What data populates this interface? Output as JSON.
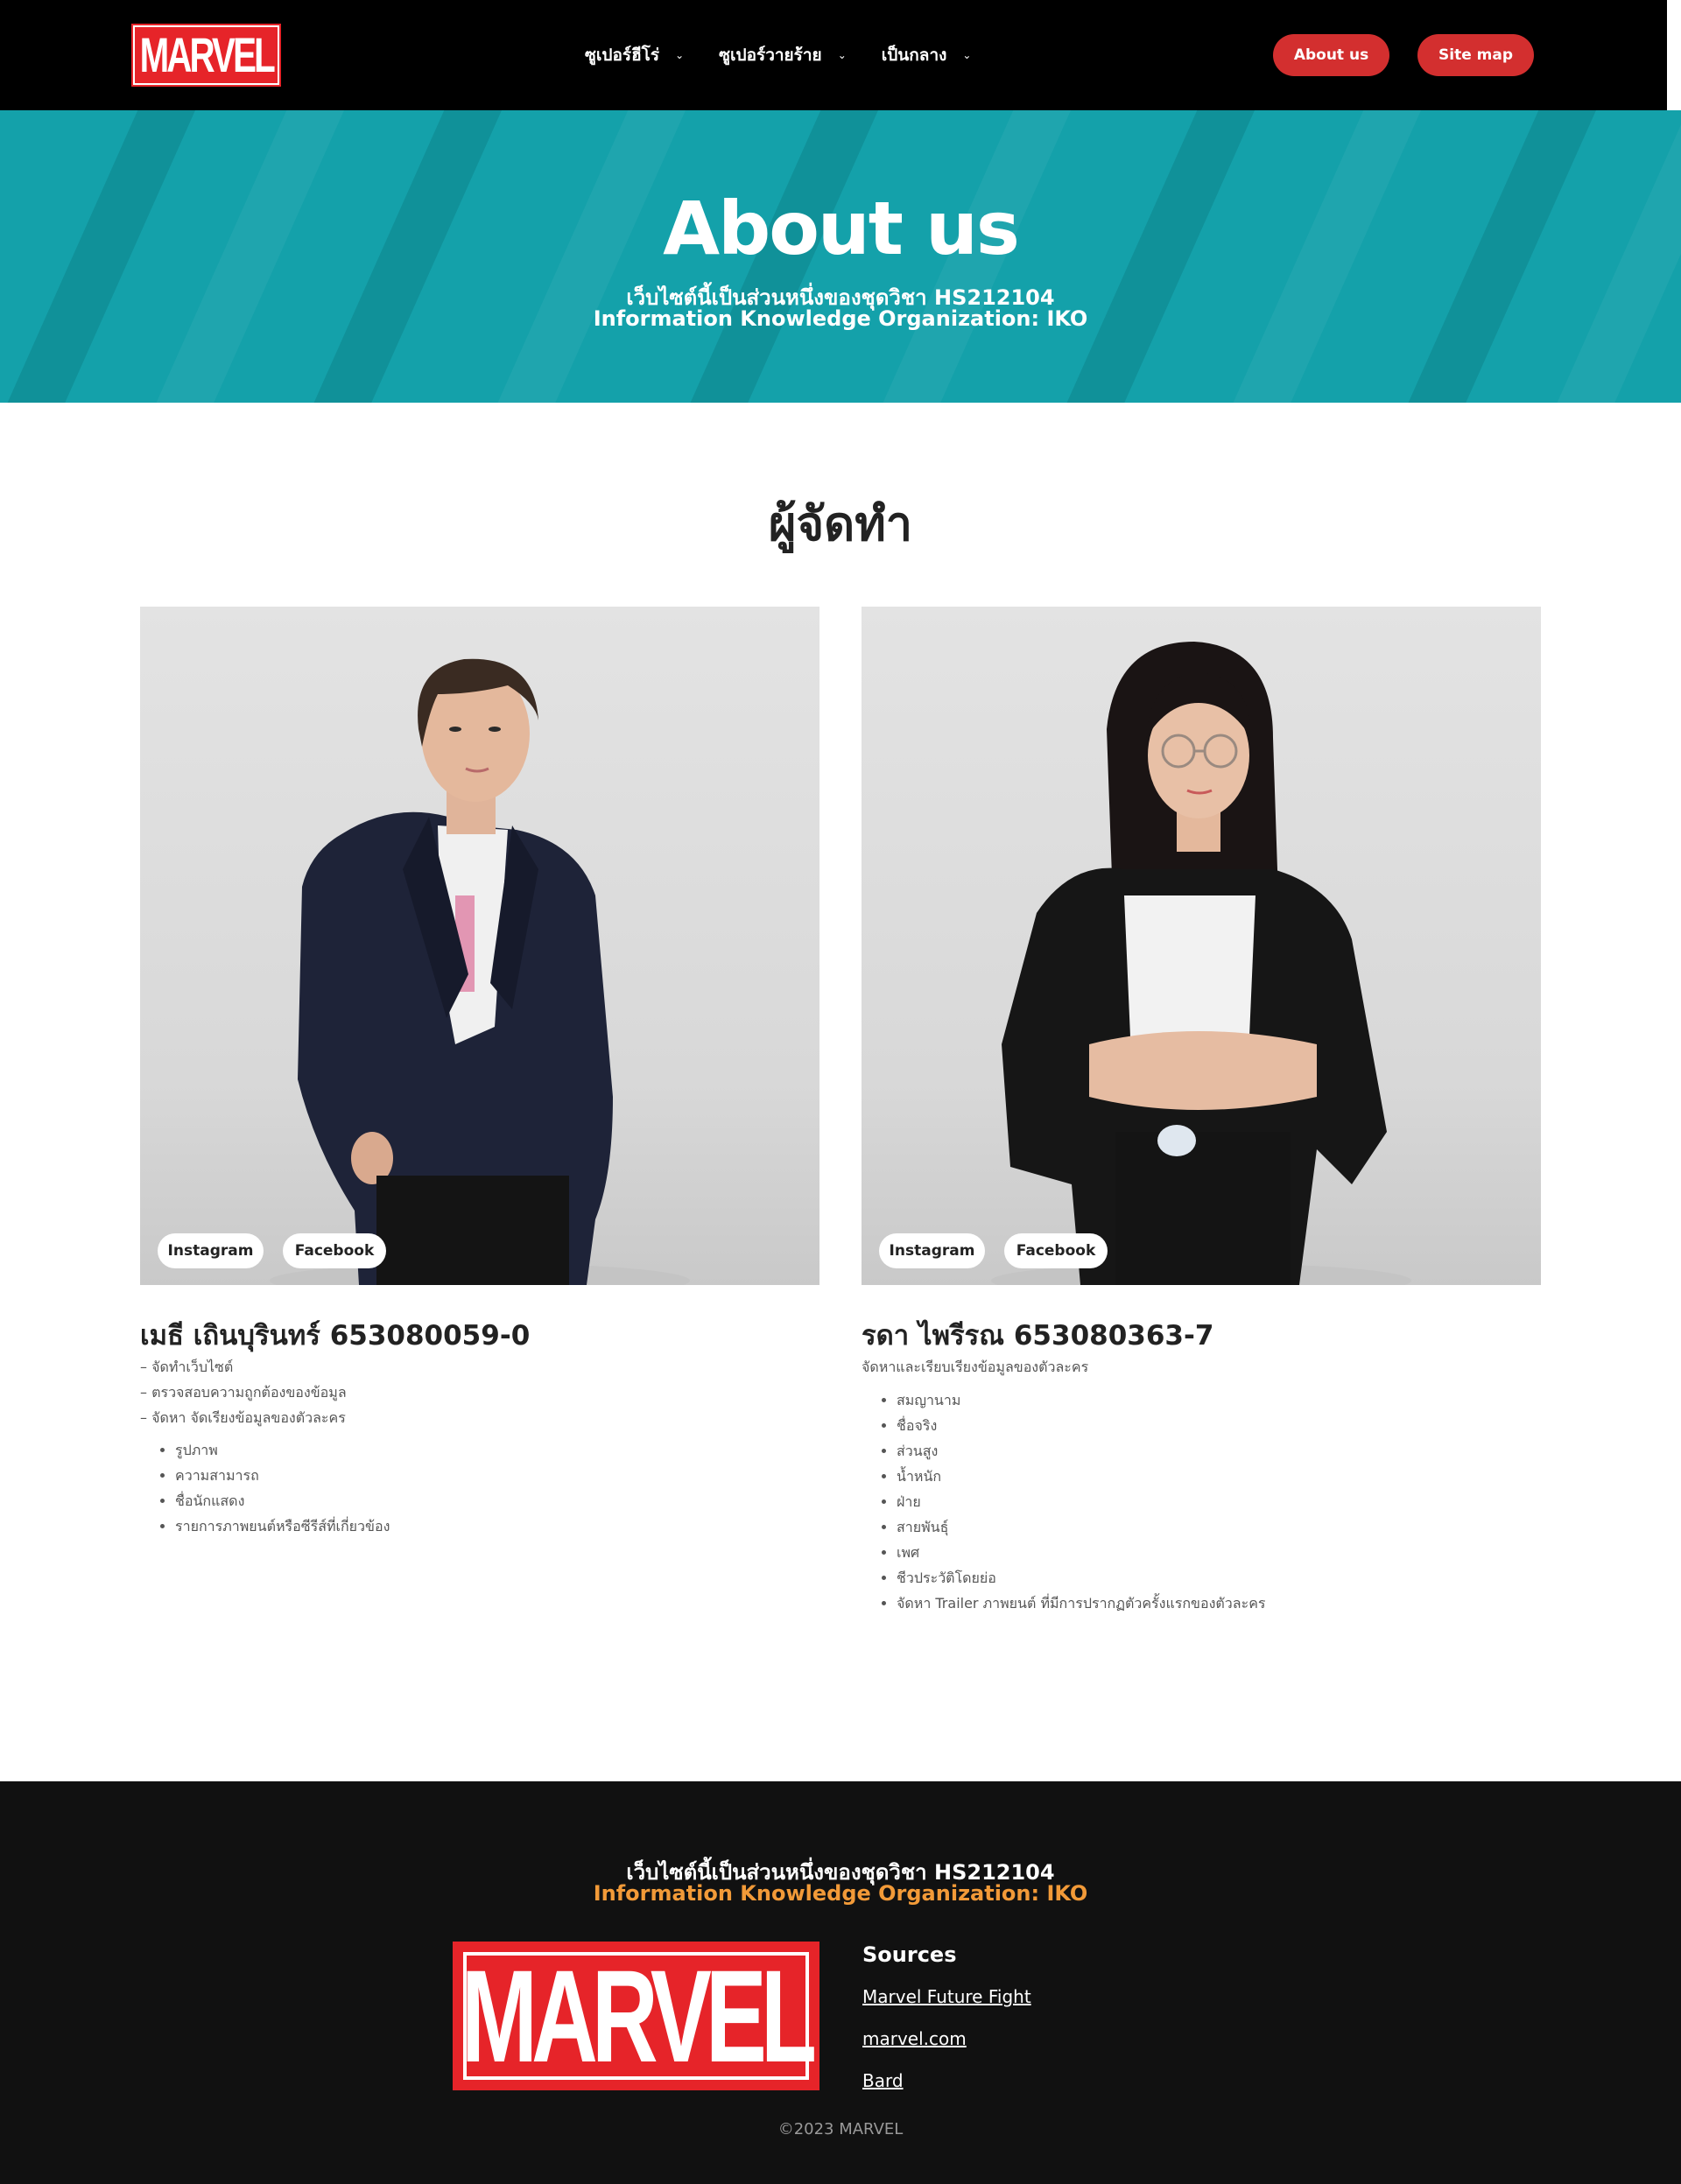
{
  "header": {
    "logo_text": "MARVEL",
    "nav": [
      {
        "label": "ซูเปอร์ฮีโร่"
      },
      {
        "label": "ซูเปอร์วายร้าย"
      },
      {
        "label": "เป็นกลาง"
      }
    ],
    "about_btn": "About us",
    "sitemap_btn": "Site map"
  },
  "hero": {
    "title": "About us",
    "subtitle_line1": "เว็บไซต์นี้เป็นส่วนหนึ่งของชุดวิชา HS212104",
    "subtitle_line2": "Information Knowledge Organization: IKO"
  },
  "section": {
    "title": "ผู้จัดทำ"
  },
  "members": [
    {
      "name": "เมธี เถินบุรินทร์ 653080059-0",
      "instagram": "Instagram",
      "facebook": "Facebook",
      "tasks": [
        "– จัดทำเว็บไซต์",
        "– ตรวจสอบความถูกต้องของข้อมูล",
        "– จัดหา จัดเรียงข้อมูลของตัวละคร"
      ],
      "bullets": [
        "รูปภาพ",
        "ความสามารถ",
        "ชื่อนักแสดง",
        "รายการภาพยนต์หรือซีรีส์ที่เกี่ยวข้อง"
      ]
    },
    {
      "name": "รดา ไพรีรณ 653080363-7",
      "instagram": "Instagram",
      "facebook": "Facebook",
      "tasks": [
        "จัดหาและเรียบเรียงข้อมูลของตัวละคร"
      ],
      "bullets": [
        "สมญานาม",
        "ชื่อจริง",
        "ส่วนสูง",
        "น้ำหนัก",
        "ฝ่าย",
        "สายพันธุ์",
        "เพศ",
        "ชีวประวัติโดยย่อ",
        "จัดหา Trailer ภาพยนต์ ที่มีการปรากฏตัวครั้งแรกของตัวละคร"
      ]
    }
  ],
  "footer": {
    "line1": "เว็บไซต์นี้เป็นส่วนหนึ่งของชุดวิชา HS212104",
    "line2": "Information Knowledge Organization: IKO",
    "logo_text": "MARVEL",
    "sources_title": "Sources",
    "sources": [
      "Marvel Future Fight",
      "marvel.com",
      "Bard"
    ],
    "copyright": "©2023 MARVEL"
  },
  "colors": {
    "brand_red": "#e62429",
    "button_red": "#d32f2f",
    "hero_teal": "#14a1aa",
    "footer_accent": "#f29a38"
  }
}
